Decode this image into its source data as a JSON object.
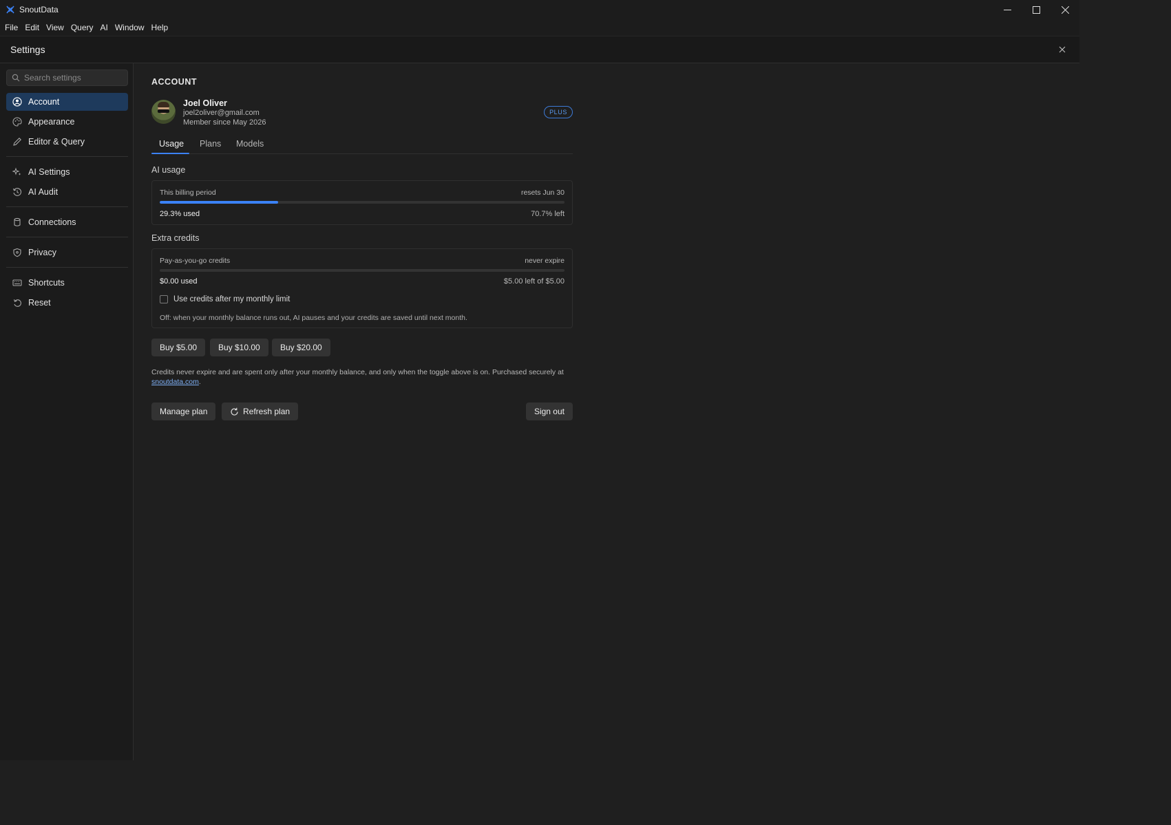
{
  "app": {
    "title": "SnoutData"
  },
  "menu": [
    "File",
    "Edit",
    "View",
    "Query",
    "AI",
    "Window",
    "Help"
  ],
  "settings": {
    "title": "Settings"
  },
  "search": {
    "placeholder": "Search settings"
  },
  "nav": {
    "account": "Account",
    "appearance": "Appearance",
    "editor_query": "Editor & Query",
    "ai_settings": "AI Settings",
    "ai_audit": "AI Audit",
    "connections": "Connections",
    "privacy": "Privacy",
    "shortcuts": "Shortcuts",
    "reset": "Reset"
  },
  "account": {
    "section_title": "ACCOUNT",
    "name": "Joel Oliver",
    "email": "joel2oliver@gmail.com",
    "member_since": "Member since May 2026",
    "plan_badge": "PLUS"
  },
  "tabs": {
    "usage": "Usage",
    "plans": "Plans",
    "models": "Models"
  },
  "ai_usage": {
    "heading": "AI usage",
    "period_label": "This billing period",
    "resets": "resets Jun 30",
    "used_percent": 29.3,
    "used_text": "29.3% used",
    "left_text": "70.7% left"
  },
  "extra_credits": {
    "heading": "Extra credits",
    "label": "Pay-as-you-go credits",
    "expiry": "never expire",
    "used_fraction": 0,
    "used_text": "$0.00 used",
    "left_text": "$5.00 left of $5.00",
    "checkbox_label": "Use credits after my monthly limit",
    "checkbox_checked": false,
    "hint": "Off: when your monthly balance runs out, AI pauses and your credits are saved until next month."
  },
  "buy_buttons": {
    "b5": "Buy $5.00",
    "b10": "Buy $10.00",
    "b20": "Buy $20.00"
  },
  "footnote": {
    "text": "Credits never expire and are spent only after your monthly balance, and only when the toggle above is on. Purchased securely at",
    "link": "snoutdata.com",
    "end": "."
  },
  "actions": {
    "manage_plan": "Manage plan",
    "refresh_plan": "Refresh plan",
    "sign_out": "Sign out"
  },
  "colors": {
    "accent": "#3b82f6",
    "active_nav": "#1e3a5c"
  }
}
